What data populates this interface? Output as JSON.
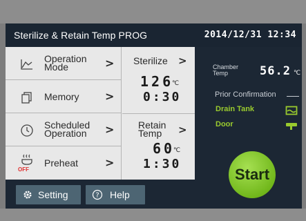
{
  "header": {
    "title": "Sterilize & Retain Temp PROG",
    "datetime": "2014/12/31 12:34"
  },
  "menu": {
    "items": [
      {
        "line1": "Operation",
        "line2": "Mode",
        "icon": "chart-line-icon"
      },
      {
        "line1": "Memory",
        "icon": "memory-cards-icon"
      },
      {
        "line1": "Scheduled",
        "line2": "Operation",
        "icon": "clock-icon"
      },
      {
        "line1": "Preheat",
        "icon": "heater-icon",
        "sub": "OFF"
      }
    ],
    "arrow": ">"
  },
  "sterilize": {
    "label": "Sterilize",
    "temp": "126",
    "unit": "℃",
    "time": "0:30"
  },
  "retain": {
    "line1": "Retain",
    "line2": "Temp",
    "temp": "60",
    "unit": "℃",
    "time": "1:30"
  },
  "status": {
    "chamber_line1": "Chamber",
    "chamber_line2": "Temp",
    "chamber_value": "56.2",
    "chamber_unit": "℃",
    "prior_label": "Prior Confirmation",
    "drain_label": "Drain Tank",
    "door_label": "Door",
    "ok_color": "#9acb2e"
  },
  "start_label": "Start",
  "footer": {
    "setting_label": "Setting",
    "help_label": "Help"
  }
}
